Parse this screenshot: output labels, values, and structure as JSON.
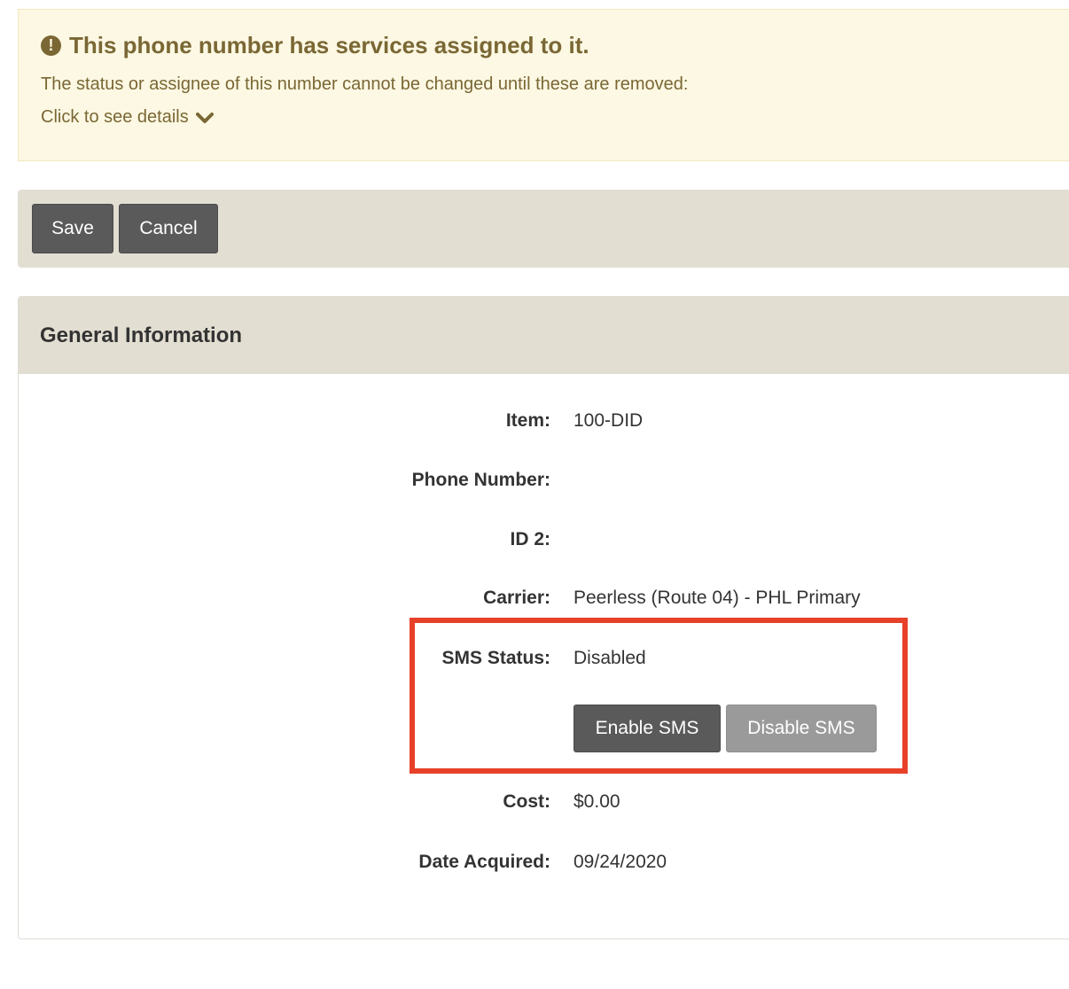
{
  "alert": {
    "icon": "exclamation-circle-icon",
    "title": "This phone number has services assigned to it.",
    "message": "The status or assignee of this number cannot be changed until these are removed:",
    "details_link": "Click to see details",
    "details_icon": "chevron-down-icon",
    "colors": {
      "background": "#fcf8e3",
      "text": "#7a6734"
    }
  },
  "toolbar": {
    "save_label": "Save",
    "cancel_label": "Cancel"
  },
  "panel": {
    "title": "General Information",
    "fields": {
      "item": {
        "label": "Item:",
        "value": "100-DID"
      },
      "phone_number": {
        "label": "Phone Number:",
        "value": ""
      },
      "id2": {
        "label": "ID 2:",
        "value": ""
      },
      "carrier": {
        "label": "Carrier:",
        "value": "Peerless (Route 04) - PHL Primary"
      },
      "sms_status": {
        "label": "SMS Status:",
        "value": "Disabled"
      },
      "cost": {
        "label": "Cost:",
        "value": "$0.00"
      },
      "date_acquired": {
        "label": "Date Acquired:",
        "value": "09/24/2020"
      }
    },
    "sms_actions": {
      "enable_label": "Enable SMS",
      "disable_label": "Disable SMS"
    }
  },
  "highlight": {
    "color": "#e8412a"
  }
}
